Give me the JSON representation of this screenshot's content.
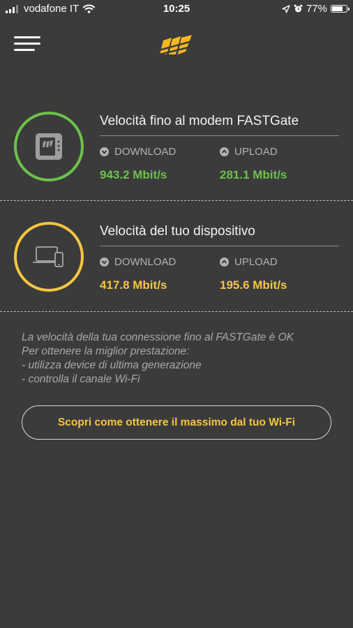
{
  "status_bar": {
    "carrier": "vodafone IT",
    "time": "10:25",
    "battery": "77%",
    "battery_level": 0.77
  },
  "header": {
    "menu_icon": "hamburger-icon",
    "logo_icon": "fastweb-logo"
  },
  "colors": {
    "background": "#3b3b3b",
    "modem_green": "#6cc24a",
    "device_yellow": "#f5c542",
    "muted_text": "#a8a8a8"
  },
  "modem_section": {
    "title": "Velocità fino al modem FASTGate",
    "download_label": "DOWNLOAD",
    "upload_label": "UPLOAD",
    "download_value": "943.2 Mbit/s",
    "upload_value": "281.1 Mbit/s",
    "icon": "modem-icon"
  },
  "device_section": {
    "title": "Velocità del tuo dispositivo",
    "download_label": "DOWNLOAD",
    "upload_label": "UPLOAD",
    "download_value": "417.8 Mbit/s",
    "upload_value": "195.6 Mbit/s",
    "icon": "devices-icon"
  },
  "note": {
    "lines": [
      "La velocità della tua connessione fino al FASTGate è OK",
      "Per ottenere la miglior prestazione:",
      "- utilizza device di ultima generazione",
      "- controlla il canale Wi-Fi"
    ]
  },
  "cta": {
    "label": "Scopri come ottenere il massimo dal tuo Wi-Fi"
  }
}
